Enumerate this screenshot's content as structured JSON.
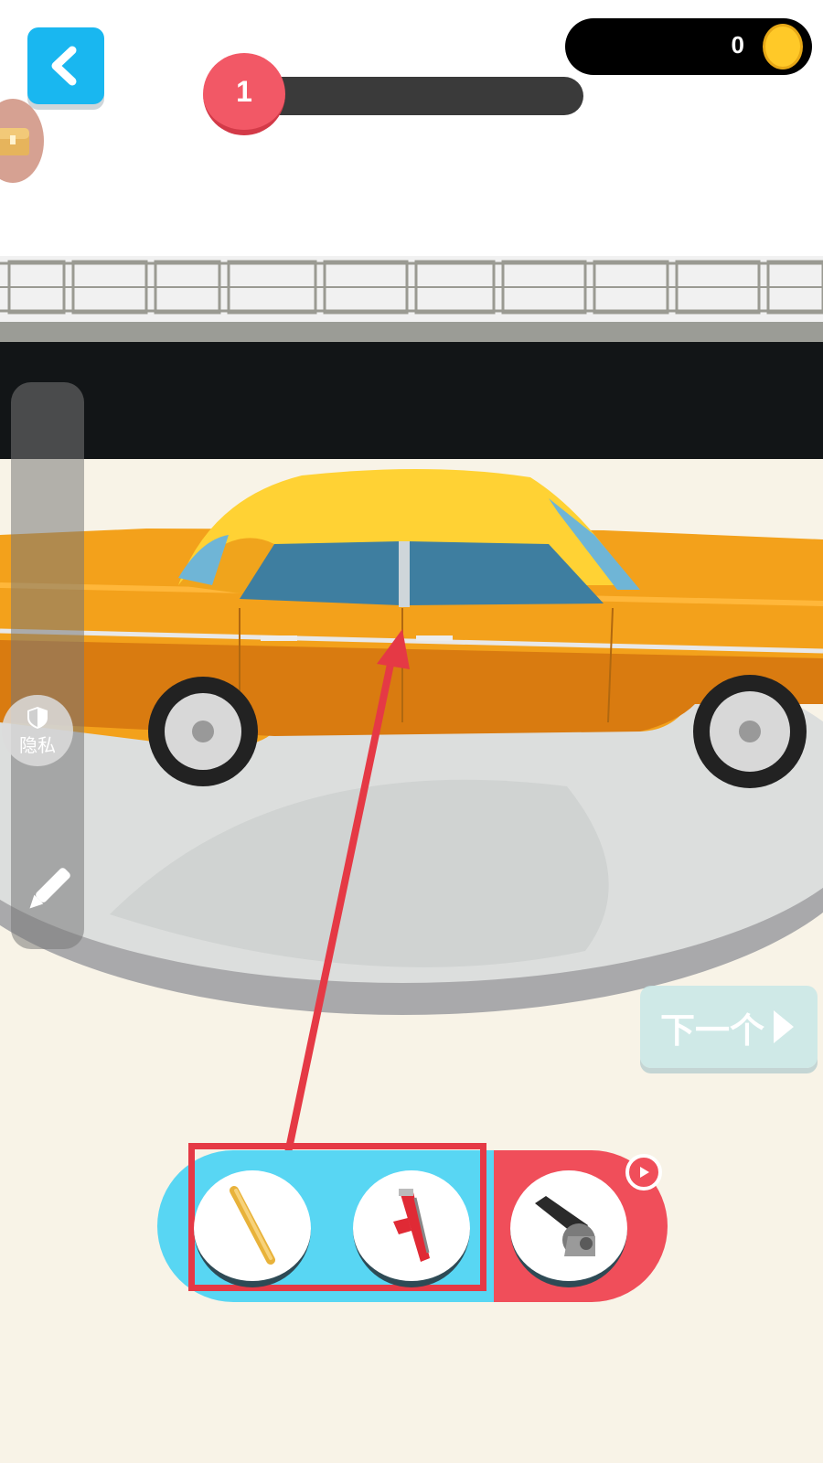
{
  "level": {
    "number": "1",
    "progress": 0
  },
  "coins": {
    "count": "0"
  },
  "side_panel": {
    "privacy_label": "隐私"
  },
  "next_button": {
    "label": "下一个"
  },
  "tools": [
    {
      "name": "baseball-bat"
    },
    {
      "name": "hacksaw"
    },
    {
      "name": "cannon",
      "locked_by_ad": true
    }
  ],
  "colors": {
    "accent_blue": "#19b7f0",
    "level_red": "#f25866",
    "tray_blue": "#58d6f3",
    "tray_red": "#f04e5a",
    "car_orange": "#f3a11b",
    "car_roof": "#ffd234",
    "highlight": "#e53945"
  }
}
